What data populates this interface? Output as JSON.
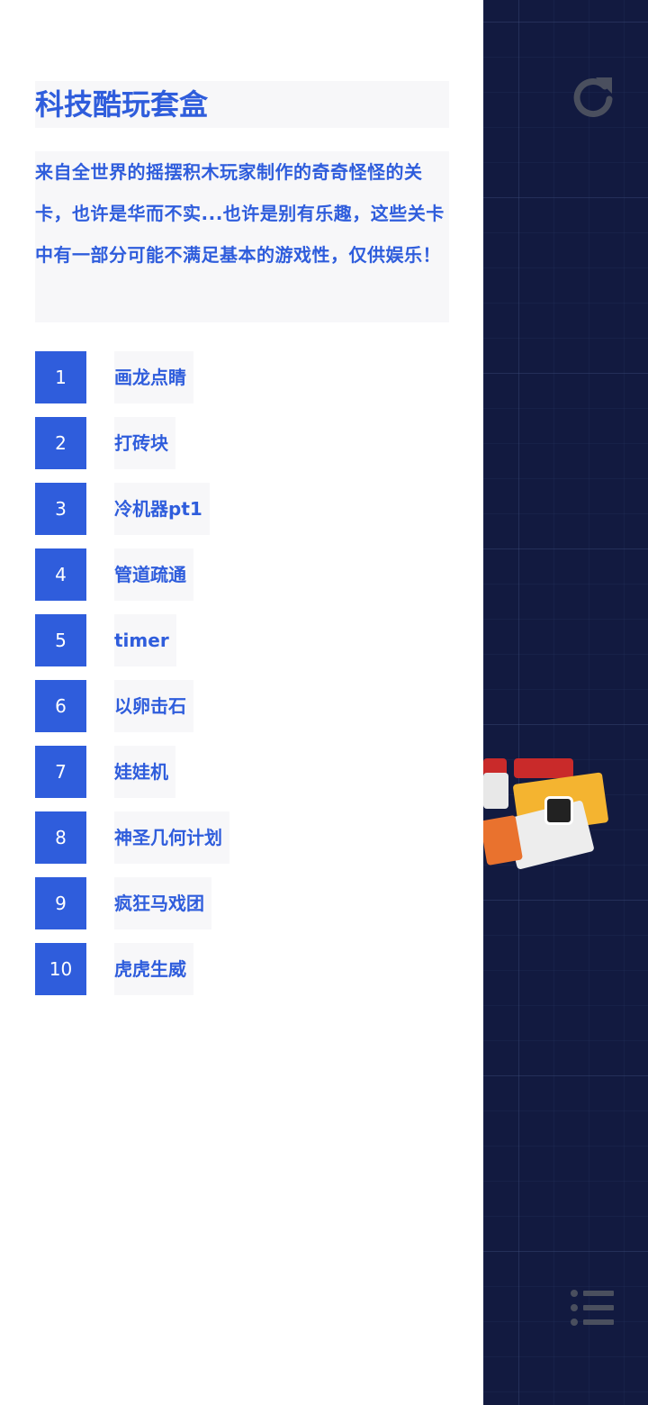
{
  "drawer": {
    "title": "科技酷玩套盒",
    "description": "来自全世界的摇摆积木玩家制作的奇奇怪怪的关卡，也许是华而不实...也许是别有乐趣，这些关卡中有一部分可能不满足基本的游戏性，仅供娱乐！",
    "levels": [
      {
        "number": "1",
        "name": "画龙点睛"
      },
      {
        "number": "2",
        "name": "打砖块"
      },
      {
        "number": "3",
        "name": "冷机器pt1"
      },
      {
        "number": "4",
        "name": "管道疏通"
      },
      {
        "number": "5",
        "name": "timer"
      },
      {
        "number": "6",
        "name": "以卵击石"
      },
      {
        "number": "7",
        "name": "娃娃机"
      },
      {
        "number": "8",
        "name": "神圣几何计划"
      },
      {
        "number": "9",
        "name": "疯狂马戏团"
      },
      {
        "number": "10",
        "name": "虎虎生威"
      }
    ]
  },
  "canvas": {
    "reload_icon": "reload-icon",
    "menu_icon": "list-menu-icon"
  },
  "colors": {
    "accent": "#2f5ddc",
    "canvas_bg": "#121a40",
    "icon_gray": "#4a4f5e"
  }
}
